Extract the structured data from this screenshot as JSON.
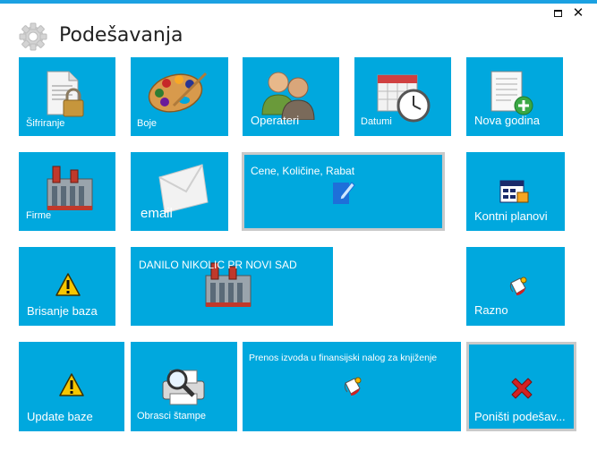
{
  "window": {
    "title": "Podešavanja",
    "maximize_label": "",
    "close_label": "✕"
  },
  "tiles": {
    "sifriranje": "Šifriranje",
    "boje": "Boje",
    "operateri": "Operateri",
    "datumi": "Datumi",
    "nova_godina": "Nova godina",
    "firme": "Firme",
    "email": "email",
    "cene": "Cene, Količine, Rabat",
    "kontni_planovi": "Kontni planovi",
    "brisanje_baza": "Brisanje baza",
    "danilo": "DANILO NIKOLIC PR NOVI SAD",
    "razno": "Razno",
    "update_baze": "Update baze",
    "obrasci_stampe": "Obrasci štampe",
    "prenos_izvoda": "Prenos izvoda u finansijski nalog za knjiženje",
    "ponisti": "Poništi podešav..."
  },
  "colors": {
    "tile": "#00a8de",
    "accent_bar": "#1ba1e2",
    "selected_border": "#c9c9c9"
  },
  "icons": {
    "sifriranje": "document-lock-icon",
    "boje": "palette-icon",
    "operateri": "users-icon",
    "datumi": "calendar-clock-icon",
    "nova_godina": "document-add-icon",
    "firme": "factory-icon",
    "email": "envelope-icon",
    "cene": "edit-icon",
    "kontni_planovi": "chart-of-accounts-icon",
    "brisanje_baza": "warning-icon",
    "danilo": "factory-icon",
    "razno": "paint-bucket-icon",
    "update_baze": "warning-icon",
    "obrasci_stampe": "print-preview-icon",
    "prenos_izvoda": "paint-bucket-icon",
    "ponisti": "red-x-icon"
  }
}
